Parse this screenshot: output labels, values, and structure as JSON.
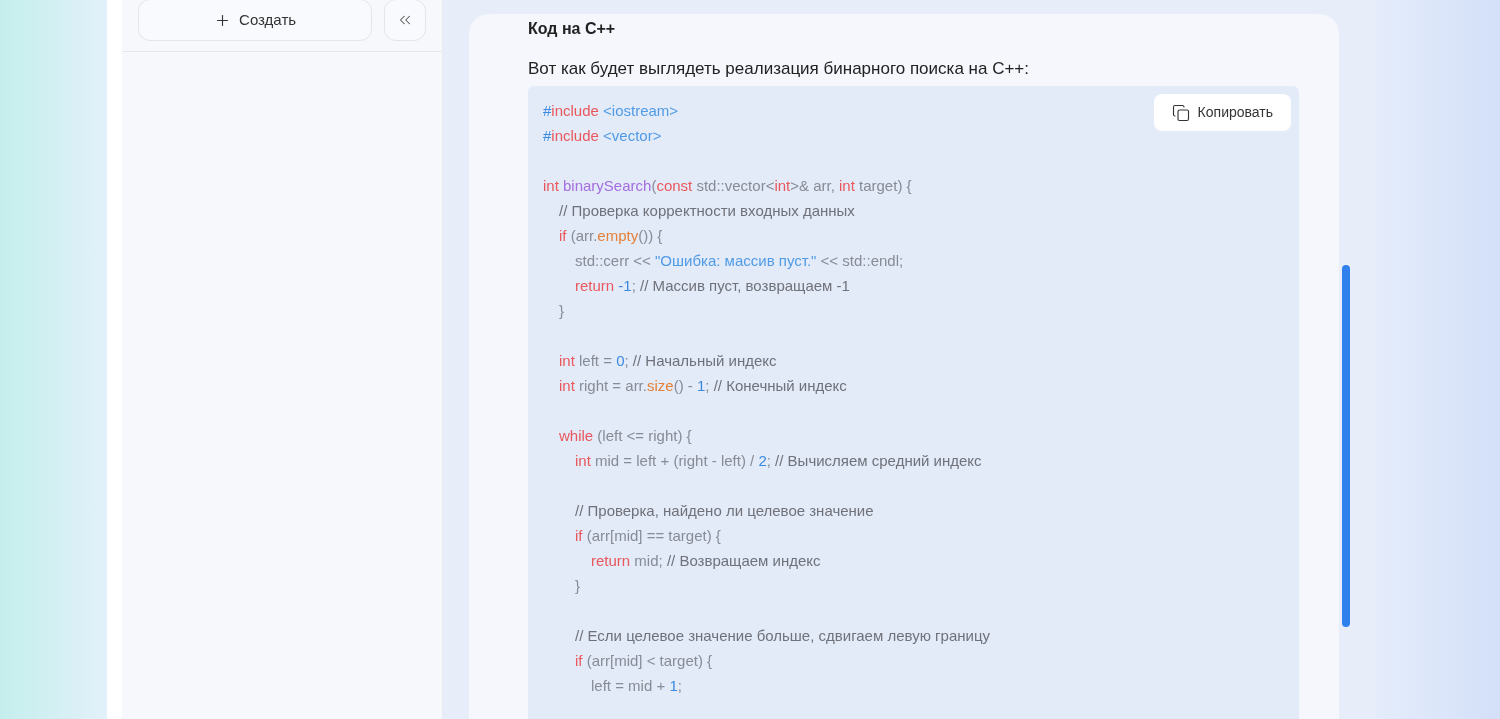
{
  "sidebar": {
    "create_button": {
      "label": "Создать"
    }
  },
  "message": {
    "heading": "Код на C++",
    "intro": "Вот как будет выглядеть реализация бинарного поиска на C++:",
    "code_block": {
      "copy_button": {
        "label": "Копировать"
      },
      "lines": [
        {
          "kind": "code",
          "tokens": [
            {
              "kind": "num",
              "text": "#"
            },
            {
              "kind": "kw",
              "text": "include"
            },
            {
              "kind": "str",
              "text": " <iostream>"
            }
          ]
        },
        {
          "kind": "code",
          "tokens": [
            {
              "kind": "num",
              "text": "#"
            },
            {
              "kind": "kw",
              "text": "include"
            },
            {
              "kind": "str",
              "text": " <vector>"
            }
          ]
        },
        {
          "kind": "blank"
        },
        {
          "kind": "code",
          "tokens": [
            {
              "kind": "kw",
              "text": "int"
            },
            {
              "kind": "fn",
              "text": " binarySearch"
            },
            {
              "kind": "plain",
              "text": "("
            },
            {
              "kind": "kw",
              "text": "const"
            },
            {
              "kind": "plain",
              "text": " std::vector<"
            },
            {
              "kind": "kw",
              "text": "int"
            },
            {
              "kind": "plain",
              "text": ">& arr, "
            },
            {
              "kind": "kw",
              "text": "int"
            },
            {
              "kind": "plain",
              "text": " target) {"
            }
          ],
          "children": [
            {
              "kind": "code",
              "tokens": [
                {
                  "kind": "comment",
                  "text": "// Проверка корректности входных данных"
                }
              ]
            },
            {
              "kind": "code",
              "tokens": [
                {
                  "kind": "kw",
                  "text": "if"
                },
                {
                  "kind": "plain",
                  "text": " (arr."
                },
                {
                  "kind": "method",
                  "text": "empty"
                },
                {
                  "kind": "plain",
                  "text": "()) {"
                }
              ],
              "children": [
                {
                  "kind": "code",
                  "tokens": [
                    {
                      "kind": "plain",
                      "text": "std::cerr << "
                    },
                    {
                      "kind": "str",
                      "text": "\"Ошибка: массив пуст.\""
                    },
                    {
                      "kind": "plain",
                      "text": " << std::endl;"
                    }
                  ]
                },
                {
                  "kind": "code",
                  "tokens": [
                    {
                      "kind": "kw",
                      "text": "return"
                    },
                    {
                      "kind": "num",
                      "text": " -1"
                    },
                    {
                      "kind": "plain",
                      "text": "; "
                    },
                    {
                      "kind": "comment",
                      "text": "// Массив пуст, возвращаем -1"
                    }
                  ]
                }
              ]
            },
            {
              "kind": "code",
              "tokens": [
                {
                  "kind": "plain",
                  "text": "}"
                }
              ]
            },
            {
              "kind": "blank"
            },
            {
              "kind": "code",
              "tokens": [
                {
                  "kind": "kw",
                  "text": "int"
                },
                {
                  "kind": "plain",
                  "text": " left = "
                },
                {
                  "kind": "num",
                  "text": "0"
                },
                {
                  "kind": "plain",
                  "text": "; "
                },
                {
                  "kind": "comment",
                  "text": "// Начальный индекс"
                }
              ]
            },
            {
              "kind": "code",
              "tokens": [
                {
                  "kind": "kw",
                  "text": "int"
                },
                {
                  "kind": "plain",
                  "text": " right = arr."
                },
                {
                  "kind": "method",
                  "text": "size"
                },
                {
                  "kind": "plain",
                  "text": "() - "
                },
                {
                  "kind": "num",
                  "text": "1"
                },
                {
                  "kind": "plain",
                  "text": "; "
                },
                {
                  "kind": "comment",
                  "text": "// Конечный индекс"
                }
              ]
            },
            {
              "kind": "blank"
            },
            {
              "kind": "code",
              "tokens": [
                {
                  "kind": "kw",
                  "text": "while"
                },
                {
                  "kind": "plain",
                  "text": " (left <= right) {"
                }
              ],
              "children": [
                {
                  "kind": "code",
                  "tokens": [
                    {
                      "kind": "kw",
                      "text": "int"
                    },
                    {
                      "kind": "plain",
                      "text": " mid = left + (right - left) / "
                    },
                    {
                      "kind": "num",
                      "text": "2"
                    },
                    {
                      "kind": "plain",
                      "text": "; "
                    },
                    {
                      "kind": "comment",
                      "text": "// Вычисляем средний индекс"
                    }
                  ]
                },
                {
                  "kind": "blank"
                },
                {
                  "kind": "code",
                  "tokens": [
                    {
                      "kind": "comment",
                      "text": "// Проверка, найдено ли целевое значение"
                    }
                  ]
                },
                {
                  "kind": "code",
                  "tokens": [
                    {
                      "kind": "kw",
                      "text": "if"
                    },
                    {
                      "kind": "plain",
                      "text": " (arr[mid] == target) {"
                    }
                  ],
                  "children": [
                    {
                      "kind": "code",
                      "tokens": [
                        {
                          "kind": "kw",
                          "text": "return"
                        },
                        {
                          "kind": "plain",
                          "text": " mid; "
                        },
                        {
                          "kind": "comment",
                          "text": "// Возвращаем индекс"
                        }
                      ]
                    }
                  ]
                },
                {
                  "kind": "code",
                  "tokens": [
                    {
                      "kind": "plain",
                      "text": "}"
                    }
                  ]
                },
                {
                  "kind": "blank"
                },
                {
                  "kind": "code",
                  "tokens": [
                    {
                      "kind": "comment",
                      "text": "// Если целевое значение больше, сдвигаем левую границу"
                    }
                  ]
                },
                {
                  "kind": "code",
                  "tokens": [
                    {
                      "kind": "kw",
                      "text": "if"
                    },
                    {
                      "kind": "plain",
                      "text": " (arr[mid] < target) {"
                    }
                  ],
                  "children": [
                    {
                      "kind": "code",
                      "tokens": [
                        {
                          "kind": "plain",
                          "text": "left = mid + "
                        },
                        {
                          "kind": "num",
                          "text": "1"
                        },
                        {
                          "kind": "plain",
                          "text": ";"
                        }
                      ]
                    }
                  ]
                }
              ]
            }
          ]
        }
      ]
    }
  }
}
